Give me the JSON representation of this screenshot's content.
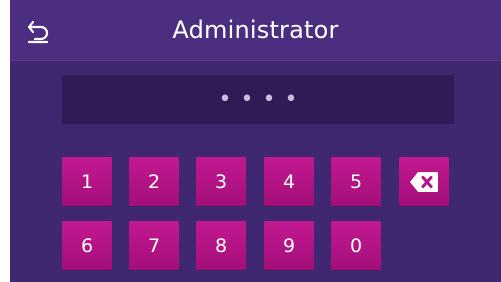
{
  "header": {
    "title": "Administrator",
    "back_icon": "undo-arrow-icon"
  },
  "pin": {
    "masked_value": "••••",
    "length": 4
  },
  "keypad": {
    "row1": [
      "1",
      "2",
      "3",
      "4",
      "5"
    ],
    "row2": [
      "6",
      "7",
      "8",
      "9",
      "0"
    ],
    "backspace_icon": "backspace-icon"
  },
  "colors": {
    "background": "#3f286f",
    "header": "#4b2e80",
    "display": "#321a55",
    "key": "#b3128a",
    "text": "#ffffff"
  }
}
